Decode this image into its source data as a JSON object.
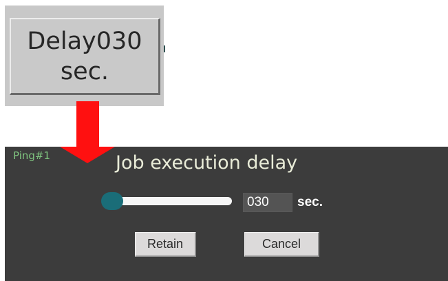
{
  "callout": {
    "line1": "Delay030",
    "line2": "sec."
  },
  "dialog": {
    "tag": "Ping#1",
    "title": "Job execution delay",
    "delay_value": "030",
    "unit": "sec.",
    "slider_level": 0.0,
    "retain_label": "Retain",
    "cancel_label": "Cancel"
  },
  "colors": {
    "dialog_bg": "#3c3c3c",
    "tag_green": "#7fc47f",
    "title_text": "#e9ecd8",
    "slider_thumb": "#1a6d78",
    "arrow_red": "#ff1010",
    "button_bg": "#dcdada"
  },
  "icons": {
    "arrow": "red-down-arrow-icon"
  }
}
